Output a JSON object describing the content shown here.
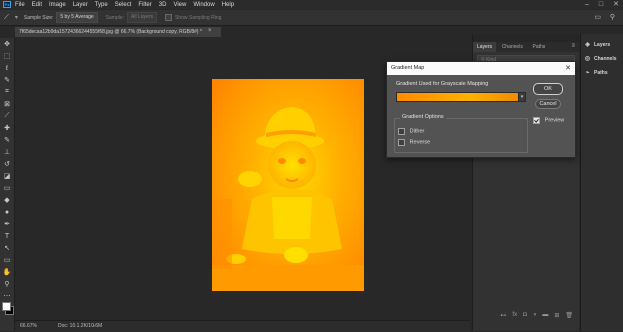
{
  "menu": {
    "logo": "Ps",
    "items": [
      "File",
      "Edit",
      "Image",
      "Layer",
      "Type",
      "Select",
      "Filter",
      "3D",
      "View",
      "Window",
      "Help"
    ]
  },
  "window_controls": [
    "–",
    "□",
    "✕"
  ],
  "options_bar": {
    "sample_size_label": "Sample Size:",
    "sample_size_value": "5 by 5 Average",
    "sample_label": "Sample:",
    "sample_value": "All Layers",
    "show_sampling_ring": "Show Sampling Ring"
  },
  "document": {
    "tab_title": "7f65decaa12b9da15724366244555f68.jpg @ 66.7% (Background copy, RGB/8#) *",
    "zoom": "66.67%",
    "doc_info": "Doc: 10.1.2K/10.6M"
  },
  "tools": [
    {
      "name": "move-tool",
      "icon": "✥"
    },
    {
      "name": "marquee-tool",
      "icon": "⬚"
    },
    {
      "name": "lasso-tool",
      "icon": "ℓ"
    },
    {
      "name": "quick-select-tool",
      "icon": "✎"
    },
    {
      "name": "crop-tool",
      "icon": "⌗"
    },
    {
      "name": "frame-tool",
      "icon": "⊠"
    },
    {
      "name": "eyedropper-tool",
      "icon": "⟋"
    },
    {
      "name": "healing-brush-tool",
      "icon": "✚"
    },
    {
      "name": "brush-tool",
      "icon": "✎"
    },
    {
      "name": "clone-stamp-tool",
      "icon": "⊥"
    },
    {
      "name": "history-brush-tool",
      "icon": "↺"
    },
    {
      "name": "eraser-tool",
      "icon": "◪"
    },
    {
      "name": "gradient-tool",
      "icon": "▭"
    },
    {
      "name": "blur-tool",
      "icon": "◆"
    },
    {
      "name": "dodge-tool",
      "icon": "●"
    },
    {
      "name": "pen-tool",
      "icon": "✒"
    },
    {
      "name": "type-tool",
      "icon": "T"
    },
    {
      "name": "path-select-tool",
      "icon": "↖"
    },
    {
      "name": "shape-tool",
      "icon": "▭"
    },
    {
      "name": "hand-tool",
      "icon": "✋"
    },
    {
      "name": "zoom-tool",
      "icon": "⚲"
    },
    {
      "name": "more-tools",
      "icon": "⋯"
    }
  ],
  "layers_panel": {
    "tabs": [
      "Layers",
      "Channels",
      "Paths"
    ],
    "active_tab": "Layers",
    "search_placeholder": "Kind"
  },
  "right_dock": {
    "items": [
      {
        "label": "Layers",
        "icon": "◈"
      },
      {
        "label": "Channels",
        "icon": "◎"
      },
      {
        "label": "Paths",
        "icon": "⌁"
      }
    ]
  },
  "dialog": {
    "title": "Gradient Map",
    "close_label": "✕",
    "gradient_group_label": "Gradient Used for Grayscale Mapping",
    "ok_label": "OK",
    "cancel_label": "Cancel",
    "preview_label": "Preview",
    "preview_checked": true,
    "options_group_label": "Gradient Options",
    "dither_label": "Dither",
    "dither_checked": false,
    "reverse_label": "Reverse",
    "reverse_checked": false,
    "gradient_colors": [
      "#ff8a00",
      "#ffb000",
      "#f08a00"
    ]
  },
  "colors": {
    "foreground": "#ffffff",
    "background": "#000000",
    "accent": "#2fa3f5"
  }
}
